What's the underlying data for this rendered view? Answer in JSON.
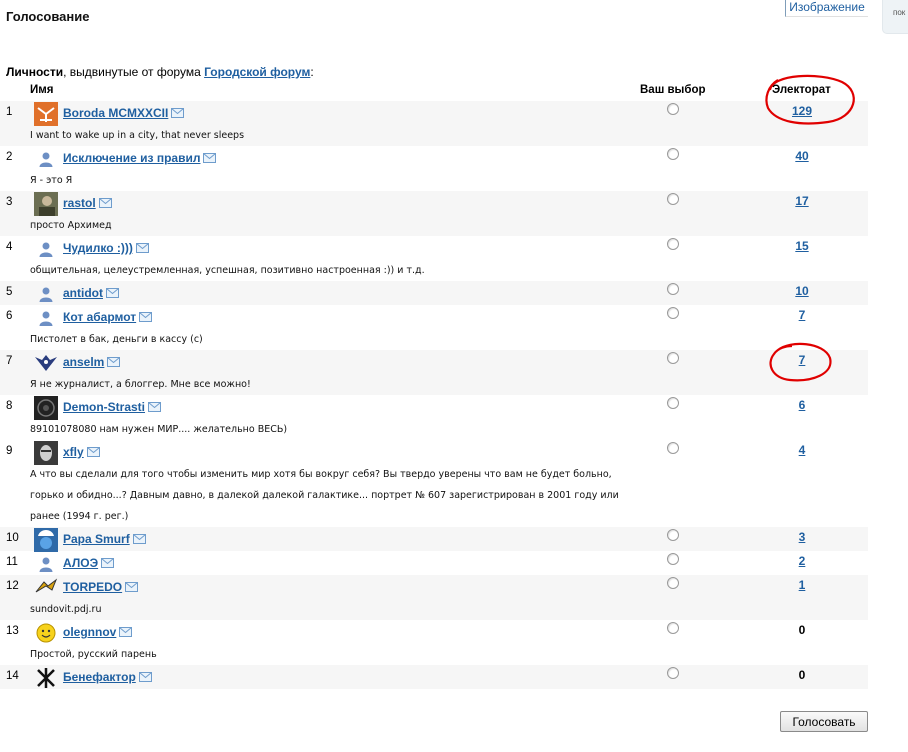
{
  "page": {
    "title": "Голосование",
    "image_link": "Изображение",
    "side_tab": "пок"
  },
  "intro": {
    "bold": "Личности",
    "text": ", выдвинутые от форума ",
    "forum_link": "Городской форум",
    "colon": ":"
  },
  "headers": {
    "name": "Имя",
    "choice": "Ваш выбор",
    "electorate": "Электорат"
  },
  "candidates": [
    {
      "rank": "1",
      "name": "Boroda MCMXXCII",
      "status": [
        "I want to wake up in a city, that never sleeps"
      ],
      "votes": "129",
      "link": true,
      "avatar": "logo-avatar"
    },
    {
      "rank": "2",
      "name": "Исключение из правил",
      "status": [
        "Я - это Я"
      ],
      "votes": "40",
      "link": true,
      "avatar": "default-user-icon"
    },
    {
      "rank": "3",
      "name": "rastol",
      "status": [
        "просто Архимед"
      ],
      "votes": "17",
      "link": true,
      "avatar": "photo-avatar"
    },
    {
      "rank": "4",
      "name": "Чудилко :)))",
      "status": [
        "общительная, целеустремленная, успешная, позитивно настроенная :)) и т.д."
      ],
      "votes": "15",
      "link": true,
      "avatar": "default-user-icon"
    },
    {
      "rank": "5",
      "name": "antidot",
      "status": [],
      "votes": "10",
      "link": true,
      "avatar": "default-user-icon"
    },
    {
      "rank": "6",
      "name": "Кот абармот",
      "status": [
        "Пистолет в бак, деньги в кассу (с)"
      ],
      "votes": "7",
      "link": true,
      "avatar": "default-user-icon"
    },
    {
      "rank": "7",
      "name": "anselm",
      "status": [
        "Я не журналист, а блоггер. Мне все можно!"
      ],
      "votes": "7",
      "link": true,
      "avatar": "wings-avatar"
    },
    {
      "rank": "8",
      "name": "Demon-Strasti",
      "status": [
        "89101078080 нам нужен МИР.... желательно ВЕСЬ)"
      ],
      "votes": "6",
      "link": true,
      "avatar": "dark-avatar"
    },
    {
      "rank": "9",
      "name": "xfly",
      "status": [
        "А что вы сделали для того чтобы изменить мир хотя бы вокруг себя? Вы твердо уверены что вам не будет больно,",
        "горько и обидно...? Давным давно, в далекой далекой галактике... портрет № 607 зарегистрирован в 2001 году или",
        "ранее (1994 г. рег.)"
      ],
      "votes": "4",
      "link": true,
      "avatar": "face-avatar"
    },
    {
      "rank": "10",
      "name": "Papa Smurf",
      "status": [],
      "votes": "3",
      "link": true,
      "avatar": "smurf-avatar"
    },
    {
      "rank": "11",
      "name": "АЛОЭ",
      "status": [],
      "votes": "2",
      "link": true,
      "avatar": "default-user-icon"
    },
    {
      "rank": "12",
      "name": "TORPEDO",
      "status": [
        "sundovit.pdj.ru"
      ],
      "votes": "1",
      "link": true,
      "avatar": "torpedo-avatar"
    },
    {
      "rank": "13",
      "name": "olegnnov",
      "status": [
        "Простой, русский парень"
      ],
      "votes": "0",
      "link": false,
      "avatar": "smiley-avatar"
    },
    {
      "rank": "14",
      "name": "Бенефактор",
      "status": [],
      "votes": "0",
      "link": false,
      "avatar": "cross-avatar"
    }
  ],
  "vote_button": "Голосовать",
  "colors": {
    "link": "#1f5fa0",
    "row_shade": "#f6f6f6",
    "annotation": "#e00000"
  }
}
